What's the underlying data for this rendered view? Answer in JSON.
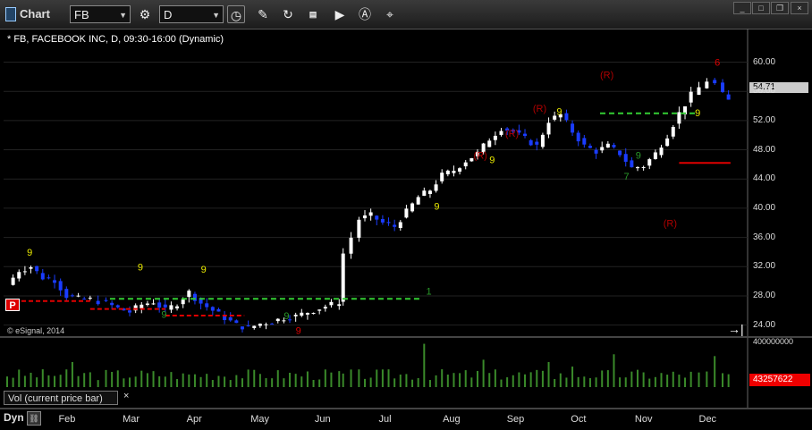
{
  "toolbar": {
    "app_title": "Chart",
    "symbol_value": "FB",
    "interval_value": "D",
    "icons": [
      "chart-settings-icon",
      "clock-icon",
      "pencil-icon",
      "cursor-icon",
      "qqq-icon",
      "play-icon",
      "alert-icon",
      "tag-icon"
    ]
  },
  "window": {
    "minimize": "_",
    "maximize": "□",
    "close": "×"
  },
  "chart_header": "* FB, FACEBOOK INC, D, 09:30-16:00 (Dynamic)",
  "marker_label": "P",
  "copyright": "© eSignal, 2014",
  "end_icon": "→|",
  "volume_pane": {
    "label": "Vol (current price bar)",
    "close": "×",
    "scale_top": "400000000",
    "current_value": "43257622"
  },
  "footer": {
    "dyn_label": "Dyn"
  },
  "colors": {
    "up": "#ffffff",
    "down": "#1a3cff",
    "count_yellow": "#e8e800",
    "count_green": "#2a9a2a",
    "count_red": "#e00000",
    "r_label": "#b00000",
    "green_line": "#33cc33",
    "red_line": "#e00000",
    "volume": "#3a8a2a"
  },
  "chart_data": {
    "type": "candlestick",
    "title": "* FB, FACEBOOK INC, D, 09:30-16:00 (Dynamic)",
    "x_labels": [
      "Feb",
      "Mar",
      "Apr",
      "May",
      "Jun",
      "Jul",
      "Aug",
      "Sep",
      "Oct",
      "Nov",
      "Dec"
    ],
    "y_ticks": [
      24,
      28,
      32,
      36,
      40,
      44,
      48,
      52,
      56,
      60
    ],
    "ylim": [
      22,
      63
    ],
    "current_price": "54.71",
    "close_path": [
      {
        "m": 0.0,
        "c": 29.5
      },
      {
        "m": 0.3,
        "c": 31.5
      },
      {
        "m": 0.6,
        "c": 32.0
      },
      {
        "m": 0.9,
        "c": 30.5
      },
      {
        "m": 1.2,
        "c": 30.2
      },
      {
        "m": 1.5,
        "c": 28.0
      },
      {
        "m": 1.8,
        "c": 27.6
      },
      {
        "m": 2.1,
        "c": 27.5
      },
      {
        "m": 2.5,
        "c": 27.0
      },
      {
        "m": 2.8,
        "c": 26.3
      },
      {
        "m": 3.1,
        "c": 25.8
      },
      {
        "m": 3.4,
        "c": 26.8
      },
      {
        "m": 3.7,
        "c": 27.2
      },
      {
        "m": 4.0,
        "c": 26.0
      },
      {
        "m": 4.3,
        "c": 27.0
      },
      {
        "m": 4.6,
        "c": 28.5
      },
      {
        "m": 4.9,
        "c": 27.0
      },
      {
        "m": 5.2,
        "c": 26.0
      },
      {
        "m": 5.5,
        "c": 25.0
      },
      {
        "m": 5.8,
        "c": 24.0
      },
      {
        "m": 6.1,
        "c": 23.6
      },
      {
        "m": 6.4,
        "c": 24.2
      },
      {
        "m": 6.7,
        "c": 24.5
      },
      {
        "m": 7.0,
        "c": 25.0
      },
      {
        "m": 7.3,
        "c": 25.2
      },
      {
        "m": 7.6,
        "c": 25.8
      },
      {
        "m": 7.9,
        "c": 26.3
      },
      {
        "m": 8.2,
        "c": 26.8
      },
      {
        "m": 8.4,
        "c": 27.2
      },
      {
        "m": 8.5,
        "c": 33.8
      },
      {
        "m": 8.7,
        "c": 36.0
      },
      {
        "m": 8.9,
        "c": 38.5
      },
      {
        "m": 9.2,
        "c": 39.0
      },
      {
        "m": 9.5,
        "c": 38.0
      },
      {
        "m": 9.8,
        "c": 37.5
      },
      {
        "m": 10.1,
        "c": 39.5
      },
      {
        "m": 10.4,
        "c": 41.5
      },
      {
        "m": 10.7,
        "c": 42.5
      },
      {
        "m": 11.0,
        "c": 44.5
      },
      {
        "m": 11.3,
        "c": 45.2
      },
      {
        "m": 11.6,
        "c": 46.5
      },
      {
        "m": 11.9,
        "c": 47.5
      },
      {
        "m": 12.2,
        "c": 49.5
      },
      {
        "m": 12.5,
        "c": 51.0
      },
      {
        "m": 12.8,
        "c": 50.5
      },
      {
        "m": 13.1,
        "c": 49.5
      },
      {
        "m": 13.4,
        "c": 48.5
      },
      {
        "m": 13.7,
        "c": 52.0
      },
      {
        "m": 14.0,
        "c": 52.8
      },
      {
        "m": 14.3,
        "c": 50.5
      },
      {
        "m": 14.6,
        "c": 48.5
      },
      {
        "m": 14.9,
        "c": 47.8
      },
      {
        "m": 15.2,
        "c": 48.5
      },
      {
        "m": 15.5,
        "c": 47.5
      },
      {
        "m": 15.8,
        "c": 45.5
      },
      {
        "m": 16.1,
        "c": 45.8
      },
      {
        "m": 16.4,
        "c": 47.5
      },
      {
        "m": 16.7,
        "c": 50.0
      },
      {
        "m": 17.0,
        "c": 53.0
      },
      {
        "m": 17.3,
        "c": 55.5
      },
      {
        "m": 17.5,
        "c": 56.5
      },
      {
        "m": 17.7,
        "c": 57.5
      },
      {
        "m": 17.9,
        "c": 57.0
      },
      {
        "m": 18.1,
        "c": 55.5
      },
      {
        "m": 18.25,
        "c": 54.7
      }
    ],
    "support_resistance": [
      {
        "color": "red",
        "y": 27.3,
        "from": 0.0,
        "to": 2.1
      },
      {
        "color": "red",
        "y": 26.2,
        "from": 2.1,
        "to": 4.0
      },
      {
        "color": "red",
        "y": 25.3,
        "from": 4.0,
        "to": 6.0
      },
      {
        "color": "green",
        "y": 27.6,
        "from": 2.6,
        "to": 10.5
      },
      {
        "color": "green",
        "y": 53.0,
        "from": 15.0,
        "to": 17.4
      },
      {
        "color": "red",
        "y": 46.2,
        "from": 17.0,
        "to": 18.3
      }
    ],
    "annotations": [
      {
        "text": "1",
        "color": "green",
        "m": 10.6,
        "y": 28.2
      },
      {
        "text": "(R)",
        "color": "r_label",
        "m": 11.8,
        "y": 46.8
      },
      {
        "text": "(R)",
        "color": "r_label",
        "m": 12.6,
        "y": 49.8
      },
      {
        "text": "(R)",
        "color": "r_label",
        "m": 13.3,
        "y": 53.2
      },
      {
        "text": "(R)",
        "color": "r_label",
        "m": 15.0,
        "y": 57.8
      },
      {
        "text": "(R)",
        "color": "r_label",
        "m": 16.6,
        "y": 37.5
      },
      {
        "text": "7",
        "color": "green",
        "m": 15.6,
        "y": 43.9
      },
      {
        "text": "9",
        "color": "yellow",
        "m": 0.5,
        "y": 33.5
      },
      {
        "text": "9",
        "color": "yellow",
        "m": 3.3,
        "y": 31.5
      },
      {
        "text": "9",
        "color": "yellow",
        "m": 4.9,
        "y": 31.2
      },
      {
        "text": "9",
        "color": "yellow",
        "m": 10.8,
        "y": 39.8
      },
      {
        "text": "9",
        "color": "yellow",
        "m": 12.2,
        "y": 46.2
      },
      {
        "text": "9",
        "color": "yellow",
        "m": 13.9,
        "y": 52.8
      },
      {
        "text": "9",
        "color": "yellow",
        "m": 17.4,
        "y": 52.6
      },
      {
        "text": "9",
        "color": "green",
        "m": 3.9,
        "y": 25.0
      },
      {
        "text": "9",
        "color": "green",
        "m": 7.0,
        "y": 24.8
      },
      {
        "text": "9",
        "color": "green",
        "m": 15.9,
        "y": 46.8
      },
      {
        "text": "6",
        "color": "red",
        "m": 17.9,
        "y": 59.5
      },
      {
        "text": "9",
        "color": "red",
        "m": 7.3,
        "y": 22.8
      }
    ],
    "volume_spikes": [
      {
        "m": 10.5,
        "v": 0.95
      },
      {
        "m": 1.6,
        "v": 0.55
      },
      {
        "m": 4.5,
        "v": 0.3
      },
      {
        "m": 15.4,
        "v": 0.72
      },
      {
        "m": 12.1,
        "v": 0.6
      },
      {
        "m": 17.9,
        "v": 0.68
      },
      {
        "m": 14.3,
        "v": 0.45
      },
      {
        "m": 13.7,
        "v": 0.55
      }
    ]
  }
}
